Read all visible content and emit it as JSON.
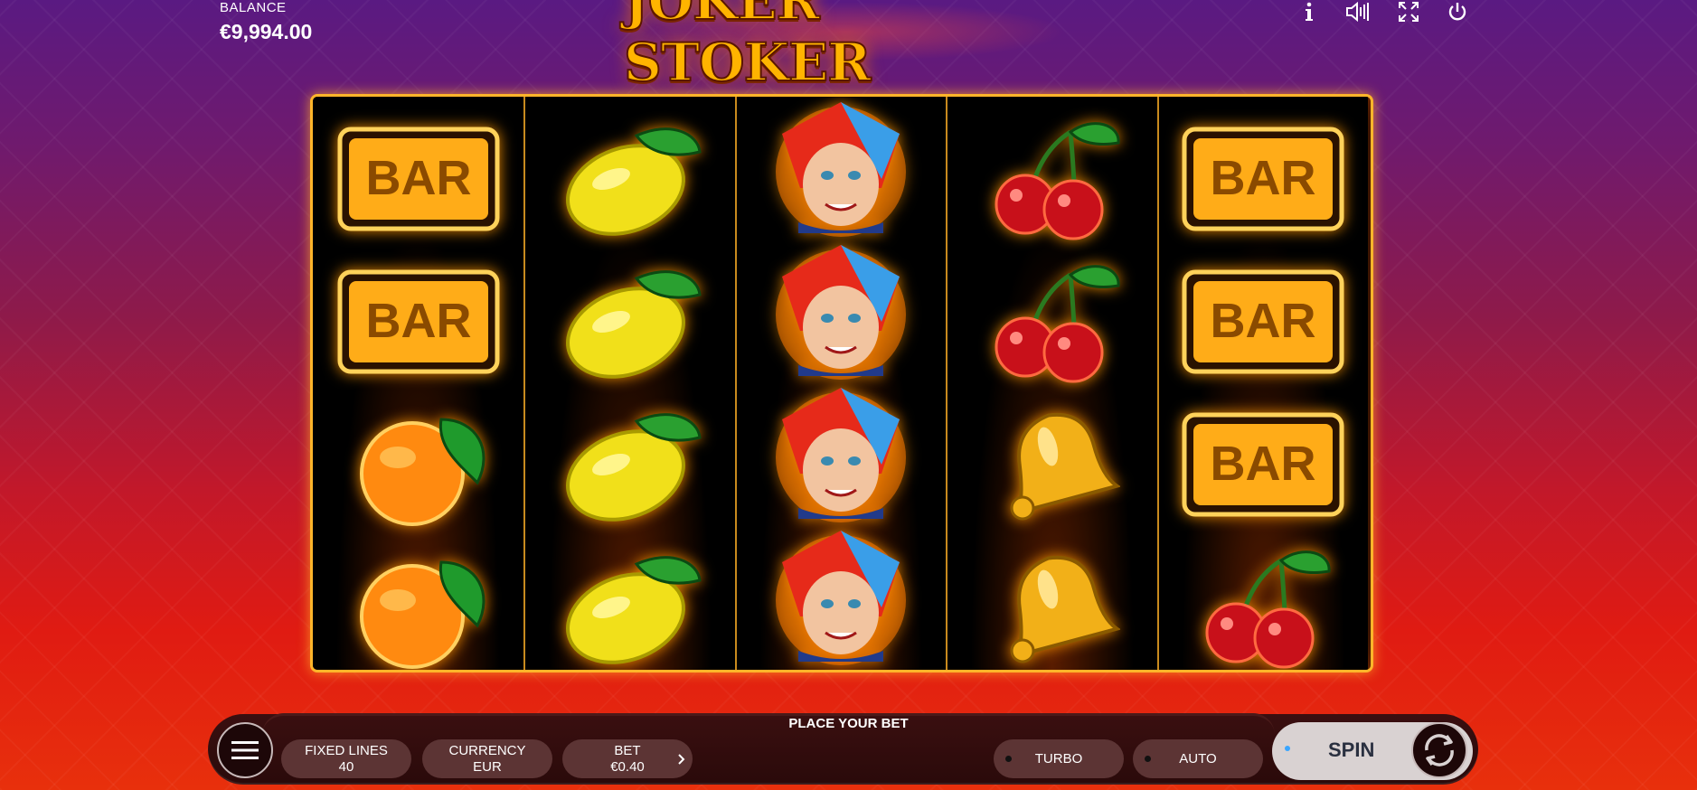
{
  "balance": {
    "label": "BALANCE",
    "value": "€9,994.00"
  },
  "logo": {
    "text": "JOKER STOKER"
  },
  "top_icons": [
    "info-icon",
    "sound-icon",
    "fullscreen-icon",
    "power-icon"
  ],
  "reels": [
    [
      "bar",
      "bar",
      "orange",
      "orange"
    ],
    [
      "lemon",
      "lemon",
      "lemon",
      "lemon"
    ],
    [
      "joker",
      "joker",
      "joker",
      "joker"
    ],
    [
      "cherry",
      "cherry",
      "bell",
      "bell"
    ],
    [
      "bar",
      "bar",
      "bar",
      "cherry"
    ]
  ],
  "symbols": {
    "bar_text": "BAR"
  },
  "bottom": {
    "message": "PLACE YOUR BET",
    "fixed_lines": {
      "label": "FIXED LINES",
      "value": "40"
    },
    "currency": {
      "label": "CURRENCY",
      "value": "EUR"
    },
    "bet": {
      "label": "BET",
      "value": "€0.40"
    },
    "turbo": "TURBO",
    "auto": "AUTO",
    "spin": "SPIN"
  },
  "colors": {
    "frame": "#ffb52a",
    "panel": "#2a0a0a",
    "pill": "#5c3434"
  }
}
